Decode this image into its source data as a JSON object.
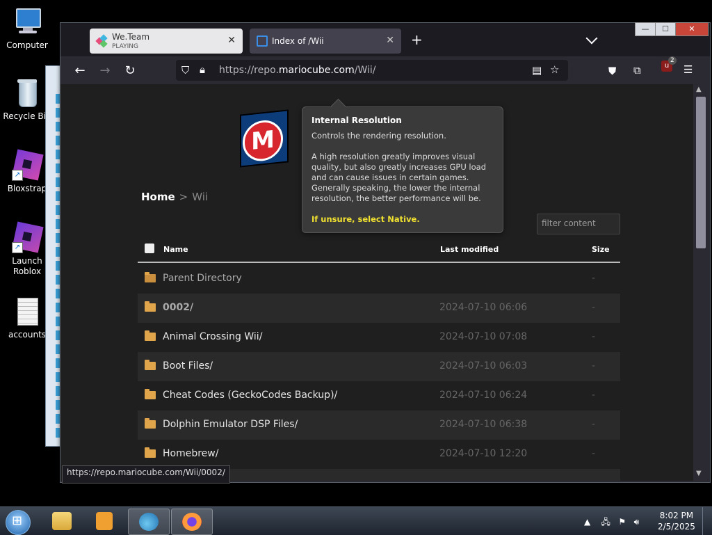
{
  "desktop": {
    "icons": [
      {
        "label": "Computer",
        "icon": "computer-icon"
      },
      {
        "label": "Recycle Bin",
        "icon": "recycle-bin-icon"
      },
      {
        "label": "Bloxstrap",
        "icon": "bloxstrap-icon"
      },
      {
        "label": "Launch Roblox",
        "icon": "roblox-icon"
      },
      {
        "label": "accounts",
        "icon": "text-file-icon"
      }
    ]
  },
  "browser": {
    "tabs": [
      {
        "title": "We.Team",
        "subtitle": "PLAYING",
        "close": "✕"
      },
      {
        "title": "Index of /Wii",
        "close": "✕"
      }
    ],
    "new_tab": "+",
    "window_controls": {
      "minimize": "—",
      "maximize": "☐",
      "close": "✕"
    },
    "url_prefix": "https://repo.",
    "url_domain": "mariocube.com",
    "url_suffix": "/Wii/",
    "extension_badge": "2",
    "status_url": "https://repo.mariocube.com/Wii/0002/"
  },
  "page": {
    "breadcrumb": {
      "home": "Home",
      "separator": ">",
      "current": "Wii"
    },
    "filter_placeholder": "filter content",
    "table": {
      "headers": {
        "name": "Name",
        "modified": "Last modified",
        "size": "Size"
      },
      "rows": [
        {
          "name": "Parent Directory",
          "modified": "",
          "size": "-"
        },
        {
          "name": "0002/",
          "modified": "2024-07-10 06:06",
          "size": "-"
        },
        {
          "name": "Animal Crossing Wii/",
          "modified": "2024-07-10 07:08",
          "size": "-"
        },
        {
          "name": "Boot Files/",
          "modified": "2024-07-10 06:03",
          "size": "-"
        },
        {
          "name": "Cheat Codes (GeckoCodes Backup)/",
          "modified": "2024-07-10 06:24",
          "size": "-"
        },
        {
          "name": "Dolphin Emulator DSP Files/",
          "modified": "2024-07-10 06:38",
          "size": "-"
        },
        {
          "name": "Homebrew/",
          "modified": "2024-07-10 12:20",
          "size": "-"
        }
      ]
    }
  },
  "tooltip": {
    "title": "Internal Resolution",
    "subtitle": "Controls the rendering resolution.",
    "body": "A high resolution greatly improves visual quality, but also greatly increases GPU load and can cause issues in certain games. Generally speaking, the lower the internal resolution, the better performance will be.",
    "hint": "If unsure, select Native."
  },
  "taskbar": {
    "time": "8:02 PM",
    "date": "2/5/2025"
  },
  "colors": {
    "accent_hint": "#f0e030",
    "folder": "#e0a54a",
    "page_bg": "#1f1f1f"
  }
}
